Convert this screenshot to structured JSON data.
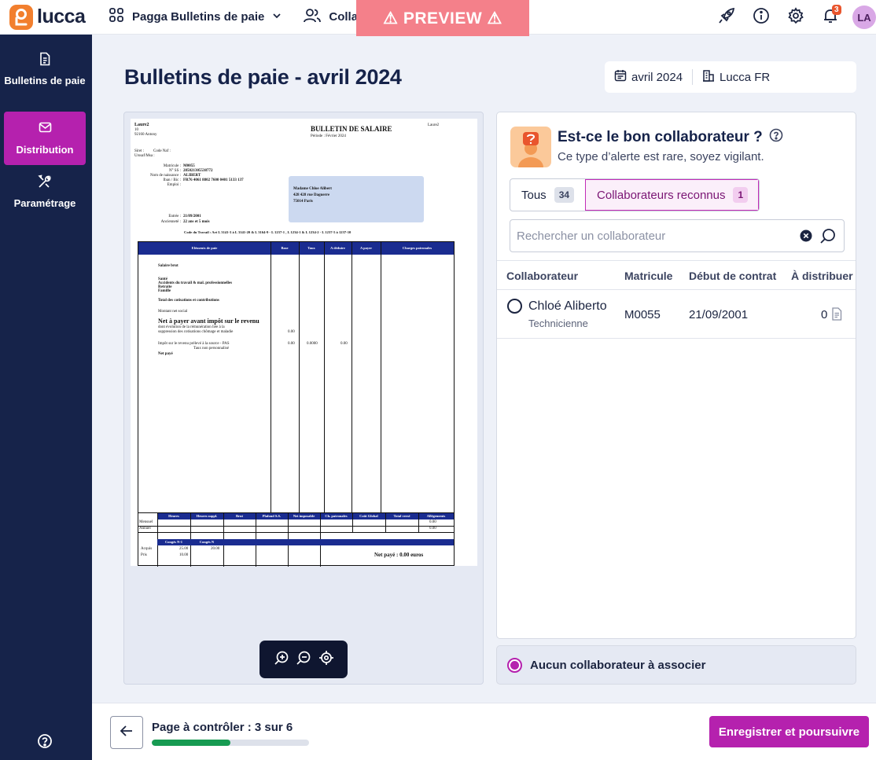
{
  "colors": {
    "brand": "#b521ae",
    "sidebar": "#16234a",
    "logo": "#f27f2e",
    "preview": "#f4808a",
    "progress": "#179b52",
    "payslip_header": "#1a2c90"
  },
  "topbar": {
    "logo_text": "lucca",
    "app_name": "Pagga Bulletins de paie",
    "collab_link": "Colla",
    "preview_banner": "⚠ PREVIEW ⚠",
    "notifications_count": "3",
    "avatar_initials": "LA",
    "icons": [
      "apps-grid-icon",
      "chevron-down-icon",
      "users-icon",
      "rocket-icon",
      "info-icon",
      "gear-icon",
      "bell-icon"
    ]
  },
  "sidebar": {
    "items": [
      {
        "label": "Bulletins de paie",
        "icon": "document-icon",
        "active": false
      },
      {
        "label": "Distribution",
        "icon": "envelope-icon",
        "active": true
      },
      {
        "label": "Paramétrage",
        "icon": "tools-icon",
        "active": false
      }
    ],
    "help_icon": "help-icon"
  },
  "main": {
    "title": "Bulletins de paie - avril 2024",
    "filters": [
      {
        "label": "avril 2024",
        "icon": "calendar-icon"
      },
      {
        "label": "Lucca FR",
        "icon": "building-icon"
      }
    ]
  },
  "payslip": {
    "employer_name": "Laure2",
    "employer_address1": "10",
    "employer_address2": "92160 Antony",
    "corner_label": "Laure2",
    "title": "BULLETIN DE SALAIRE",
    "period": "Période : Février 2024",
    "siret": "Siret :",
    "naf": "Code Naf :",
    "urssaf": "Urssaf/Msa :",
    "fields": [
      {
        "label": "Matricule :",
        "value": "M0055"
      },
      {
        "label": "N° SS :",
        "value": "285021305538772"
      },
      {
        "label": "Nom de naissance :",
        "value": "ALIBERT"
      },
      {
        "label": "Iban / Bic :",
        "value": "FR76 4061 8802 7600 0401 5133 137"
      },
      {
        "label": "Emploi :",
        "value": ""
      }
    ],
    "recipient": [
      "Madame Chloe Alibert",
      "428 428 rue Daguerre",
      "75014 Paris"
    ],
    "entry_label": "Entrée :",
    "entry_value": "21/09/2001",
    "seniority_label": "Ancienneté :",
    "seniority_value": "22 ans et 5 mois",
    "labor_code": "Code du Travail : Art L 3141-3 à L 3141-20 & L 3164-9 - L 1237-1 , L 1234-1 & L 1234-2 - L 1237-5 à 1237-10",
    "columns": [
      "Eléments de paie",
      "Base",
      "Taux",
      "A déduire",
      "A payer",
      "Charges patronales"
    ],
    "lines": {
      "brut": "Salaire brut",
      "sante": "Santé",
      "at": "Accidents du travail & mal. professionnelles",
      "retraite": "Retraite",
      "famille": "Famille",
      "total": "Total des cotisations et contributions",
      "net_social": "Montant net social",
      "net_avant": "Net à payer avant impôt sur le revenu",
      "evol1": "dont évolution de la rémunération liée à la",
      "evol2": "suppression des cotisations chômage et maladie",
      "evol_val": "0.00",
      "pas": "Impôt sur le revenu prélevé à la source - PAS",
      "pas_sub": "Taux non personnalisé",
      "pas_base": "0.00",
      "pas_taux": "0.0000",
      "pas_ded": "0.00",
      "net_paye": "Net payé"
    },
    "totals_columns": [
      "Heures",
      "Heures suppl.",
      "Brut",
      "Plafond S.S.",
      "Net imposable",
      "Ch. patronales",
      "Coût Global",
      "Total versé",
      "Allégements"
    ],
    "monthly": "Mensuel",
    "annual": "Annuel",
    "monthly_alleg": "0.00",
    "annual_alleg": "0.00",
    "leave_columns": [
      "Congés N-1",
      "Congés N"
    ],
    "acquired": "Acquis",
    "acquired_n1": "25.00",
    "acquired_n": "20.00",
    "taken": "Pris",
    "taken_n1": "10.00",
    "net_paid_total": "Net payé : 0.00 euros"
  },
  "viewer": {
    "zoom_icons": [
      "zoom-in-icon",
      "zoom-out-icon",
      "recenter-icon"
    ]
  },
  "panel": {
    "title": "Est-ce le bon collaborateur ?",
    "subtitle": "Ce type d’alerte est rare, soyez vigilant.",
    "tabs": [
      {
        "label": "Tous",
        "count": "34",
        "active": false
      },
      {
        "label": "Collaborateurs reconnus",
        "count": "1",
        "active": true
      }
    ],
    "search_placeholder": "Rechercher un collaborateur",
    "columns": [
      "Collaborateur",
      "Matricule",
      "Début de contrat",
      "À distribuer"
    ],
    "rows": [
      {
        "name": "Chloé Aliberto",
        "role": "Technicienne",
        "matricule": "M0055",
        "start": "21/09/2001",
        "to_distribute": "0"
      }
    ],
    "no_collab_label": "Aucun collaborateur à associer"
  },
  "footer": {
    "progress_label": "Page à contrôler : 3 sur 6",
    "progress_fraction": 0.5,
    "primary_label": "Enregistrer et poursuivre"
  }
}
